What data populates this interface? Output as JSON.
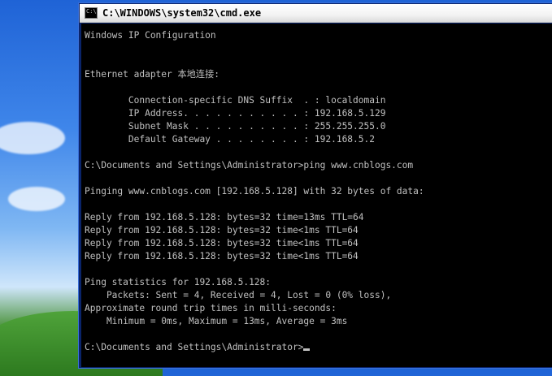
{
  "window": {
    "title": "C:\\WINDOWS\\system32\\cmd.exe",
    "icon_label": "C:\\"
  },
  "console": {
    "lines": [
      "Windows IP Configuration",
      "",
      "",
      "Ethernet adapter 本地连接:",
      "",
      "        Connection-specific DNS Suffix  . : localdomain",
      "        IP Address. . . . . . . . . . . : 192.168.5.129",
      "        Subnet Mask . . . . . . . . . . : 255.255.255.0",
      "        Default Gateway . . . . . . . . : 192.168.5.2",
      "",
      "C:\\Documents and Settings\\Administrator>ping www.cnblogs.com",
      "",
      "Pinging www.cnblogs.com [192.168.5.128] with 32 bytes of data:",
      "",
      "Reply from 192.168.5.128: bytes=32 time=13ms TTL=64",
      "Reply from 192.168.5.128: bytes=32 time<1ms TTL=64",
      "Reply from 192.168.5.128: bytes=32 time<1ms TTL=64",
      "Reply from 192.168.5.128: bytes=32 time<1ms TTL=64",
      "",
      "Ping statistics for 192.168.5.128:",
      "    Packets: Sent = 4, Received = 4, Lost = 0 (0% loss),",
      "Approximate round trip times in milli-seconds:",
      "    Minimum = 0ms, Maximum = 13ms, Average = 3ms",
      "",
      "C:\\Documents and Settings\\Administrator>"
    ]
  },
  "colors": {
    "console_bg": "#000000",
    "console_text": "#c0c0c0"
  }
}
